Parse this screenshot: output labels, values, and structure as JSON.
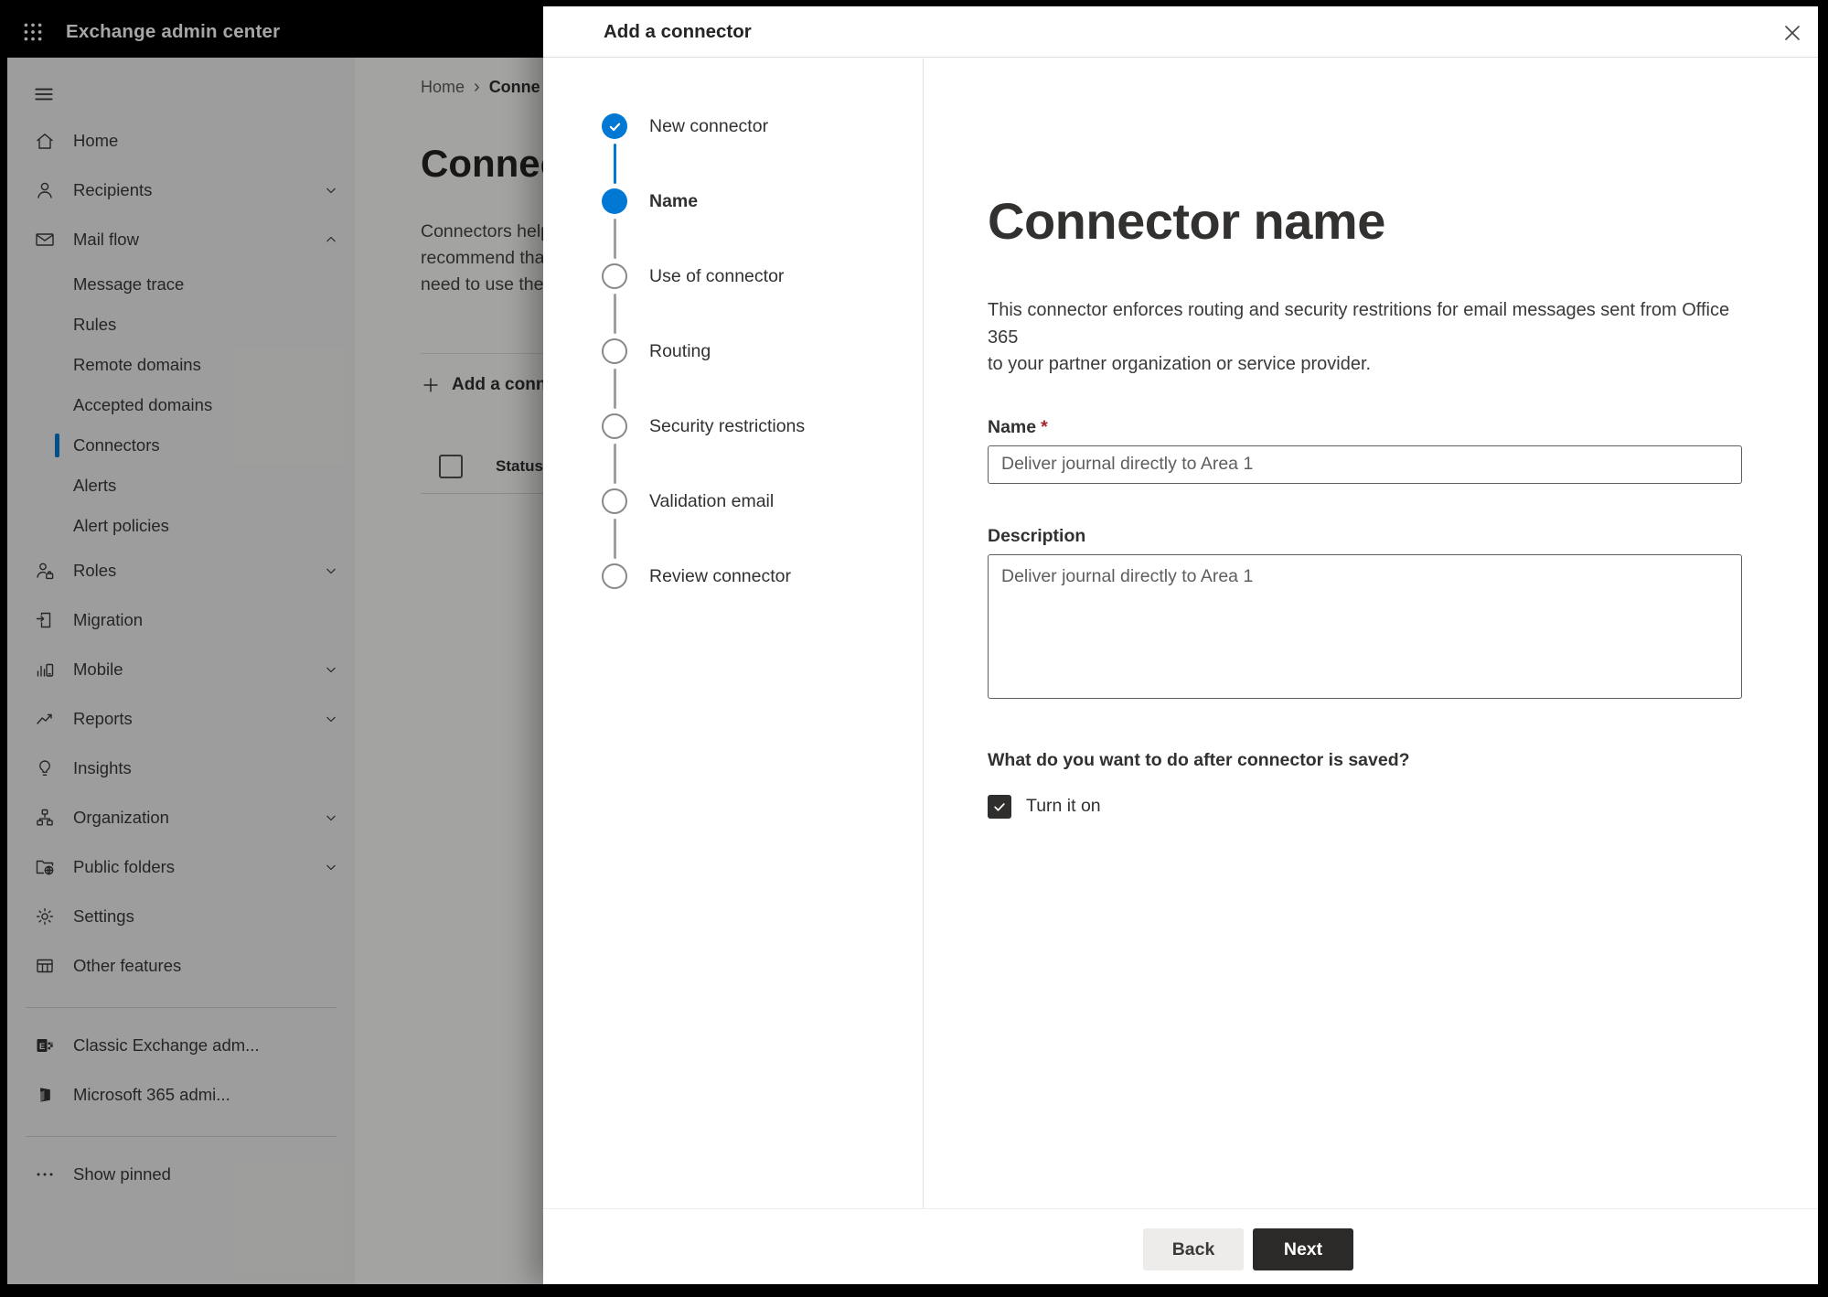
{
  "header": {
    "app_name": "Exchange admin center"
  },
  "sidebar": {
    "home": "Home",
    "recipients": "Recipients",
    "mail_flow": "Mail flow",
    "mail_flow_children": {
      "message_trace": "Message trace",
      "rules": "Rules",
      "remote_domains": "Remote domains",
      "accepted_domains": "Accepted domains",
      "connectors": "Connectors",
      "alerts": "Alerts",
      "alert_policies": "Alert policies"
    },
    "roles": "Roles",
    "migration": "Migration",
    "mobile": "Mobile",
    "reports": "Reports",
    "insights": "Insights",
    "organization": "Organization",
    "public_folders": "Public folders",
    "settings": "Settings",
    "other_features": "Other features",
    "classic_exchange": "Classic Exchange adm...",
    "m365_admin": "Microsoft 365 admi...",
    "show_pinned": "Show pinned"
  },
  "background_page": {
    "breadcrumb": {
      "home": "Home",
      "separator": "›",
      "current": "Conne"
    },
    "heading": "Connect",
    "intro_lines": [
      "Connectors help",
      "recommend that",
      "need to use them"
    ],
    "add_connector_button": "Add a conn",
    "status_column": "Status"
  },
  "modal": {
    "title": "Add a connector",
    "steps": [
      {
        "label": "New connector",
        "state": "completed"
      },
      {
        "label": "Name",
        "state": "current"
      },
      {
        "label": "Use of connector",
        "state": "upcoming"
      },
      {
        "label": "Routing",
        "state": "upcoming"
      },
      {
        "label": "Security restrictions",
        "state": "upcoming"
      },
      {
        "label": "Validation email",
        "state": "upcoming"
      },
      {
        "label": "Review connector",
        "state": "upcoming"
      }
    ],
    "content": {
      "heading": "Connector name",
      "description_lines": [
        "This connector enforces routing and security restritions for email messages sent from Office 365",
        "to your partner organization or service provider."
      ],
      "name_label": "Name",
      "required_marker": "*",
      "name_value": "Deliver journal directly to Area 1",
      "description_label": "Description",
      "description_value": "Deliver journal directly to Area 1",
      "after_save_question": "What do you want to do after connector is saved?",
      "turn_on_label": "Turn it on",
      "turn_on_checked": true
    },
    "footer": {
      "back": "Back",
      "next": "Next"
    }
  },
  "colors": {
    "accent": "#0078d4",
    "text": "#323130",
    "text_secondary": "#605e5c",
    "required": "#a4262c",
    "primary_button": "#2b2a28",
    "header_bar": "#000000"
  }
}
